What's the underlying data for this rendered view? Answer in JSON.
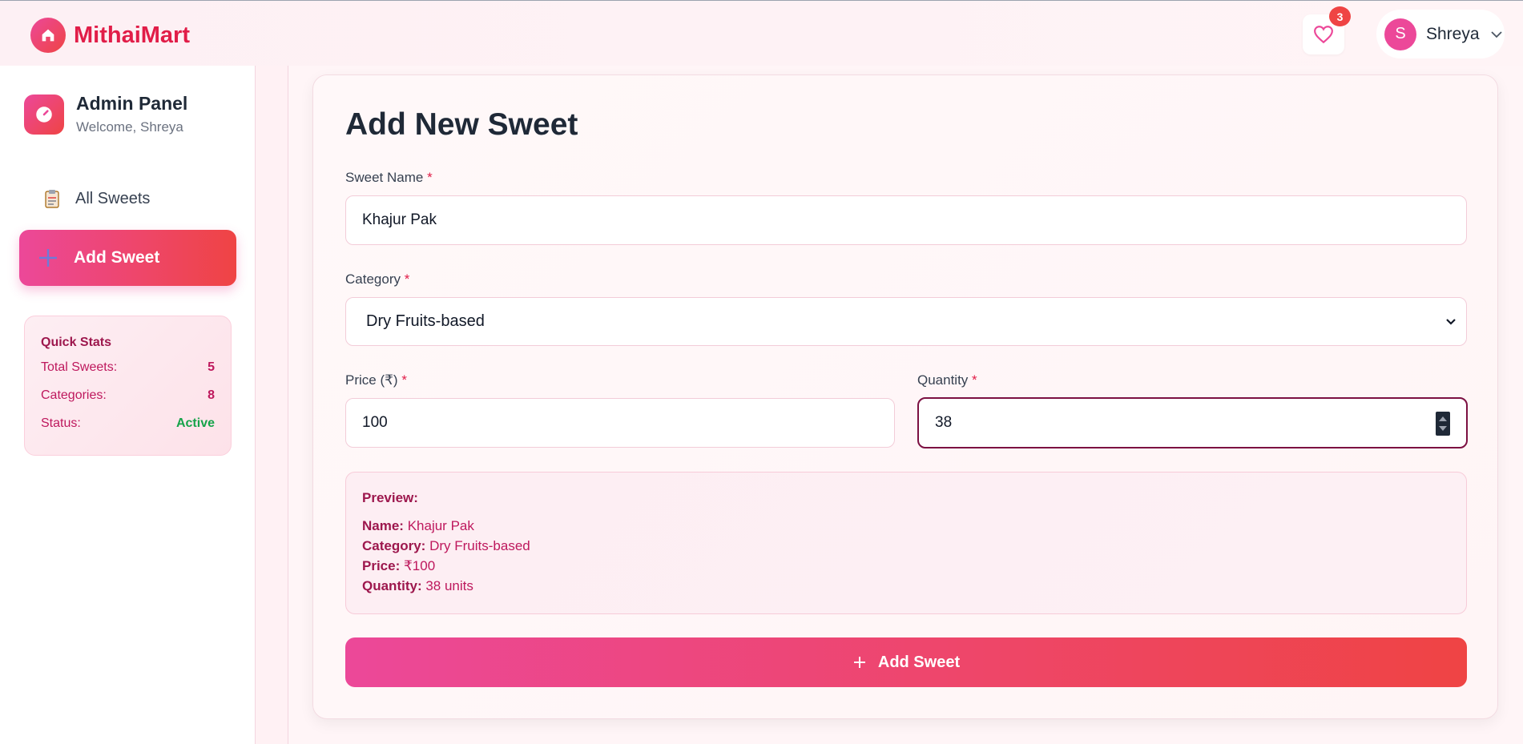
{
  "app": {
    "brand": "MithaiMart"
  },
  "header": {
    "favorites_count": "3",
    "user": {
      "initial": "S",
      "name": "Shreya"
    }
  },
  "sidebar": {
    "title": "Admin Panel",
    "welcome": "Welcome, Shreya",
    "nav": [
      {
        "label": "All Sweets",
        "icon": "clipboard-icon"
      },
      {
        "label": "Add Sweet",
        "icon": "plus-icon"
      }
    ],
    "stats": {
      "title": "Quick Stats",
      "rows": [
        {
          "label": "Total Sweets:",
          "value": "5"
        },
        {
          "label": "Categories:",
          "value": "8"
        },
        {
          "label": "Status:",
          "value": "Active"
        }
      ]
    }
  },
  "form": {
    "title": "Add New Sweet",
    "required_mark": "*",
    "name_label": "Sweet Name",
    "name_value": "Khajur Pak",
    "category_label": "Category",
    "category_value": "Dry Fruits-based",
    "price_label": "Price (₹)",
    "price_value": "100",
    "quantity_label": "Quantity",
    "quantity_value": "38",
    "submit_label": "Add Sweet"
  },
  "preview": {
    "title": "Preview:",
    "name_key": "Name:",
    "name_value": "Khajur Pak",
    "category_key": "Category:",
    "category_value": "Dry Fruits-based",
    "price_key": "Price:",
    "price_value": "₹100",
    "quantity_key": "Quantity:",
    "quantity_value": "38 units"
  },
  "colors": {
    "accent": "#ec4899",
    "accent_end": "#ef4444",
    "brand_text": "#e11d48",
    "status_active": "#16a34a"
  }
}
